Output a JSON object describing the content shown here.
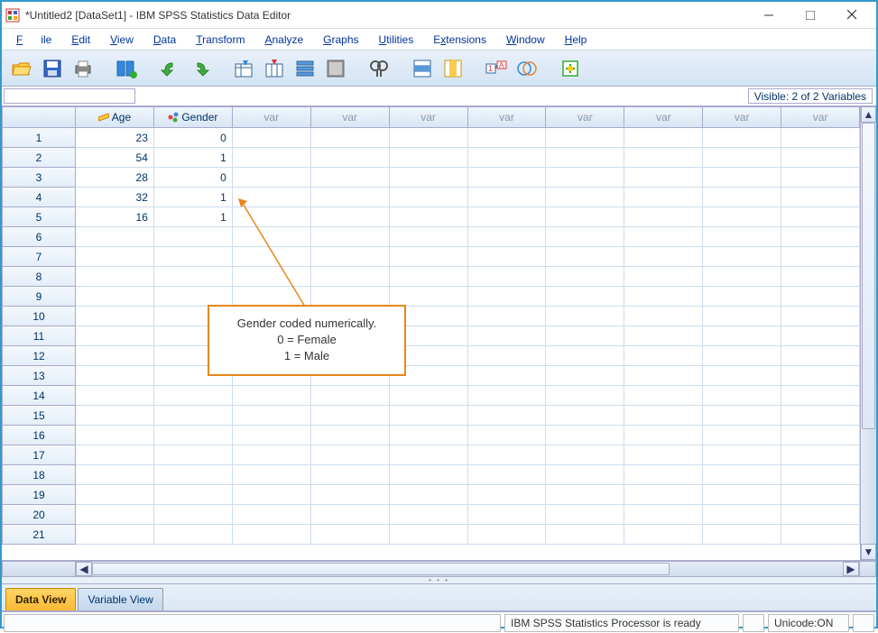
{
  "window": {
    "title": "*Untitled2 [DataSet1] - IBM SPSS Statistics Data Editor"
  },
  "menu": {
    "file": "File",
    "edit": "Edit",
    "view": "View",
    "data": "Data",
    "transform": "Transform",
    "analyze": "Analyze",
    "graphs": "Graphs",
    "utilities": "Utilities",
    "extensions": "Extensions",
    "window": "Window",
    "help": "Help"
  },
  "visible_label": "Visible: 2 of 2 Variables",
  "columns": [
    "Age",
    "Gender"
  ],
  "empty_col_label": "var",
  "rows": [
    {
      "n": "1",
      "age": "23",
      "gender": "0"
    },
    {
      "n": "2",
      "age": "54",
      "gender": "1"
    },
    {
      "n": "3",
      "age": "28",
      "gender": "0"
    },
    {
      "n": "4",
      "age": "32",
      "gender": "1"
    },
    {
      "n": "5",
      "age": "16",
      "gender": "1"
    },
    {
      "n": "6"
    },
    {
      "n": "7"
    },
    {
      "n": "8"
    },
    {
      "n": "9"
    },
    {
      "n": "10"
    },
    {
      "n": "11"
    },
    {
      "n": "12"
    },
    {
      "n": "13"
    },
    {
      "n": "14"
    },
    {
      "n": "15"
    },
    {
      "n": "16"
    },
    {
      "n": "17"
    },
    {
      "n": "18"
    },
    {
      "n": "19"
    },
    {
      "n": "20"
    },
    {
      "n": "21"
    }
  ],
  "tabs": {
    "data_view": "Data View",
    "variable_view": "Variable View"
  },
  "status": {
    "processor": "IBM SPSS Statistics Processor is ready",
    "unicode": "Unicode:ON"
  },
  "callout": {
    "l1": "Gender coded numerically.",
    "l2": "0 = Female",
    "l3": "1 = Male"
  }
}
